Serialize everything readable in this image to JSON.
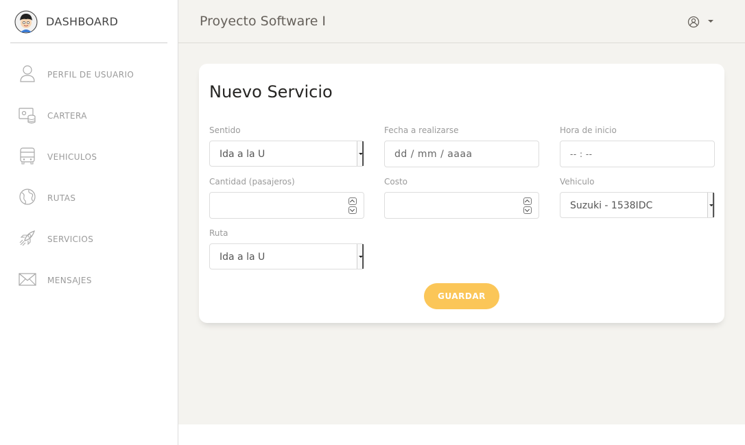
{
  "sidebar": {
    "brand": "DASHBOARD",
    "items": [
      {
        "label": "PERFIL DE USUARIO",
        "icon": "user-icon"
      },
      {
        "label": "CARTERA",
        "icon": "wallet-icon"
      },
      {
        "label": "VEHICULOS",
        "icon": "bus-icon"
      },
      {
        "label": "RUTAS",
        "icon": "globe-icon"
      },
      {
        "label": "SERVICIOS",
        "icon": "rocket-icon"
      },
      {
        "label": "MENSAJES",
        "icon": "envelope-icon"
      }
    ]
  },
  "header": {
    "title": "Proyecto Software I",
    "user_icon": "user-circle-icon"
  },
  "form": {
    "title": "Nuevo Servicio",
    "sentido": {
      "label": "Sentido",
      "value": "Ida a la U"
    },
    "fecha": {
      "label": "Fecha a realizarse",
      "placeholder": "dd / mm / aaaa"
    },
    "hora": {
      "label": "Hora de inicio",
      "placeholder": "-- : --"
    },
    "cantidad": {
      "label": "Cantidad (pasajeros)",
      "value": ""
    },
    "costo": {
      "label": "Costo",
      "value": ""
    },
    "vehiculo": {
      "label": "Vehiculo",
      "value": "Suzuki - 1538IDC"
    },
    "ruta": {
      "label": "Ruta",
      "value": "Ida a la U"
    },
    "save_label": "GUARDAR"
  },
  "colors": {
    "accent": "#fbc658",
    "background": "#f4f3ef",
    "card": "#ffffff",
    "nav_text": "#9a9a9a"
  }
}
